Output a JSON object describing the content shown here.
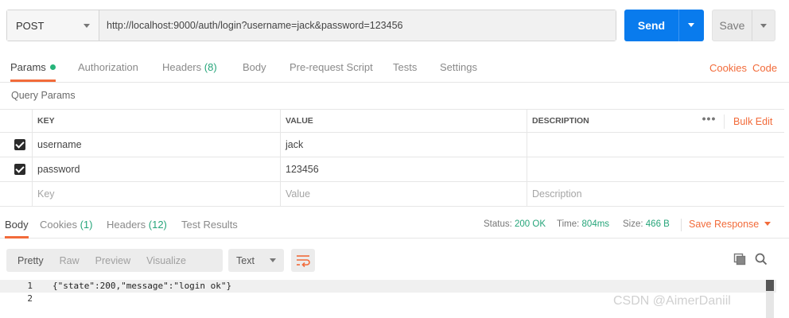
{
  "request": {
    "method": "POST",
    "url": "http://localhost:9000/auth/login?username=jack&password=123456",
    "send_label": "Send",
    "save_label": "Save"
  },
  "request_tabs": [
    {
      "label": "Params",
      "active": true,
      "dot": true
    },
    {
      "label": "Authorization"
    },
    {
      "label": "Headers",
      "count": "(8)"
    },
    {
      "label": "Body"
    },
    {
      "label": "Pre-request Script"
    },
    {
      "label": "Tests"
    },
    {
      "label": "Settings"
    }
  ],
  "links": {
    "cookies": "Cookies",
    "code": "Code"
  },
  "query_params": {
    "title": "Query Params",
    "headers": {
      "key": "KEY",
      "value": "VALUE",
      "description": "DESCRIPTION"
    },
    "more": "•••",
    "bulk_edit": "Bulk Edit",
    "rows": [
      {
        "checked": true,
        "key": "username",
        "value": "jack",
        "description": ""
      },
      {
        "checked": true,
        "key": "password",
        "value": "123456",
        "description": ""
      }
    ],
    "placeholder": {
      "key": "Key",
      "value": "Value",
      "description": "Description"
    }
  },
  "response_tabs": [
    {
      "label": "Body",
      "active": true
    },
    {
      "label": "Cookies",
      "count": "(1)"
    },
    {
      "label": "Headers",
      "count": "(12)"
    },
    {
      "label": "Test Results"
    }
  ],
  "response_status": {
    "status_label": "Status:",
    "status_value": "200 OK",
    "time_label": "Time:",
    "time_value": "804ms",
    "size_label": "Size:",
    "size_value": "466 B",
    "save_response": "Save Response"
  },
  "response_view": {
    "modes": [
      "Pretty",
      "Raw",
      "Preview",
      "Visualize"
    ],
    "active_mode": "Pretty",
    "format": "Text"
  },
  "response_body": [
    {
      "n": "1",
      "text": "{\"state\":200,\"message\":\"login ok\"}"
    },
    {
      "n": "2",
      "text": ""
    }
  ],
  "watermark": "CSDN @AimerDaniil",
  "colors": {
    "accent": "#f26b3a",
    "send": "#097bed",
    "success": "#26a57a"
  }
}
